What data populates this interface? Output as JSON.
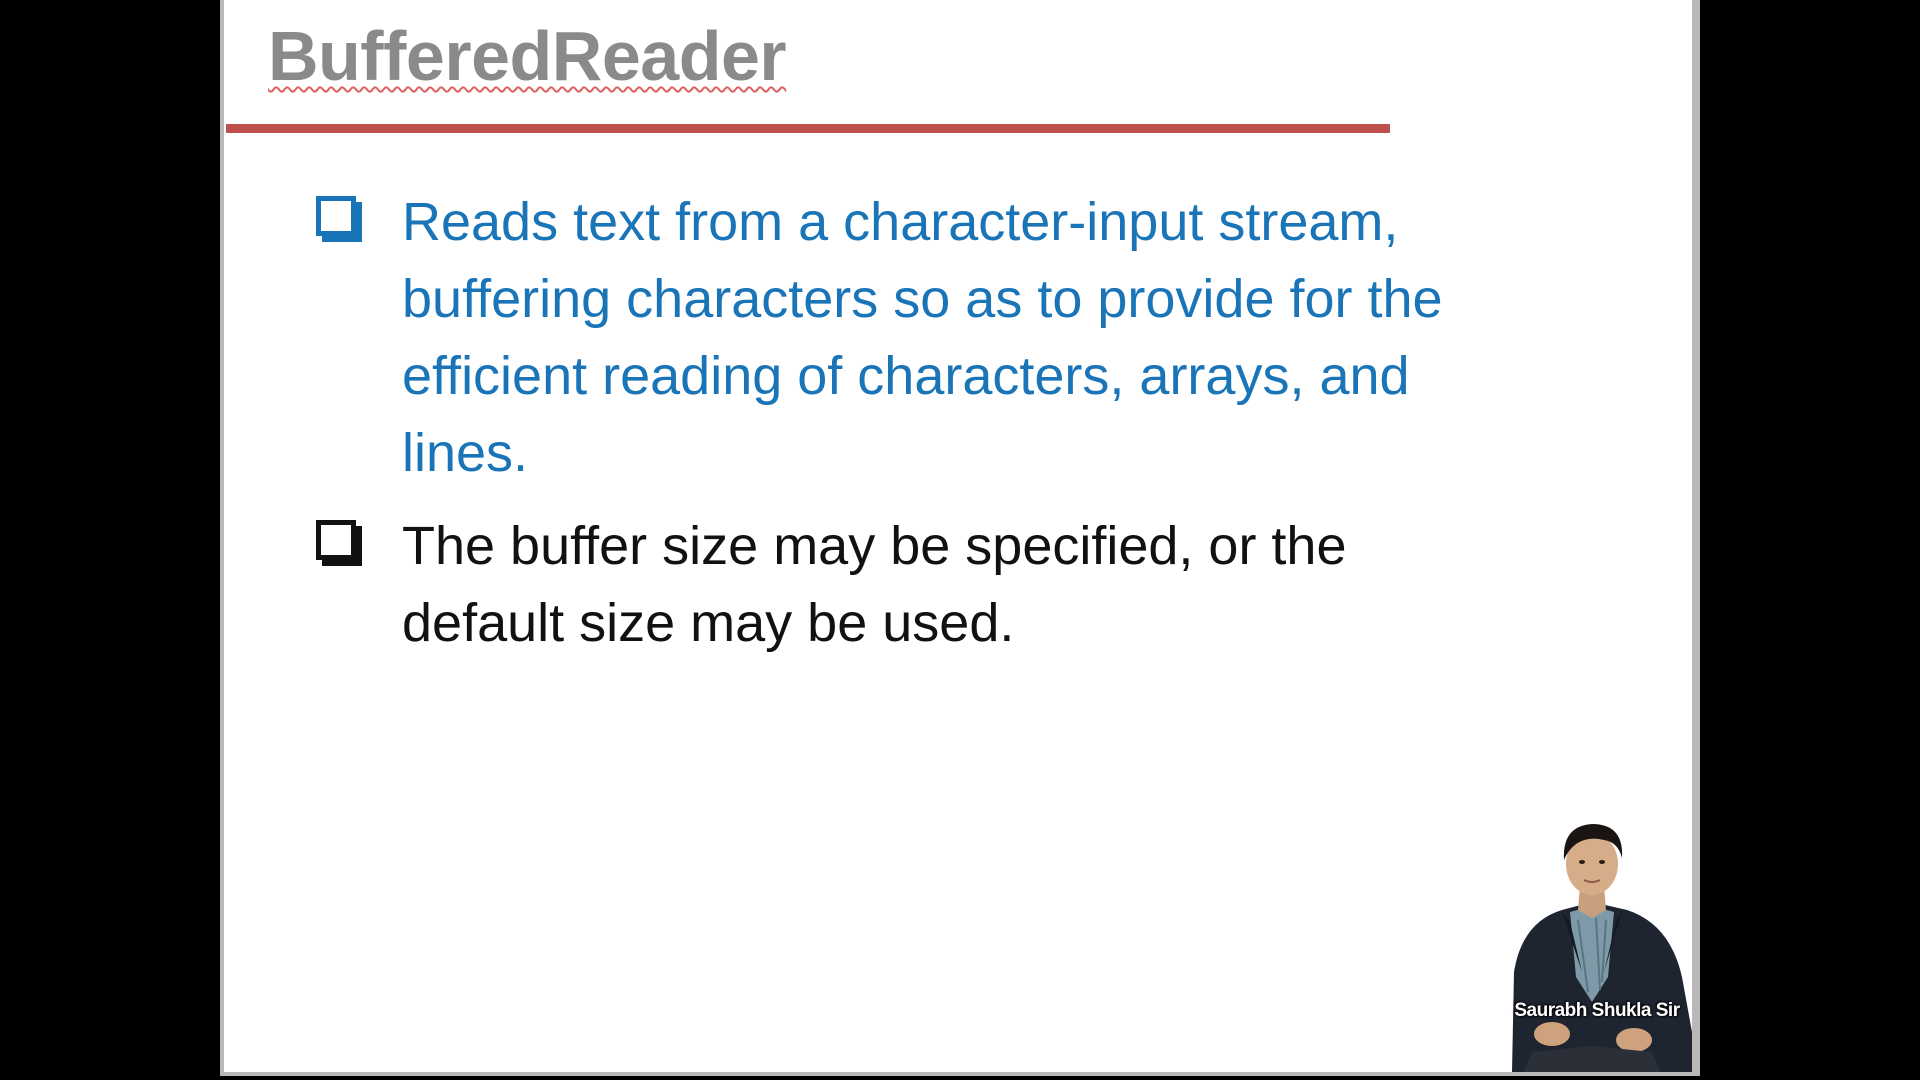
{
  "slide": {
    "title": "BufferedReader",
    "bullets": [
      {
        "lines": [
          "Reads text from a character-input stream,",
          "buffering characters so as to provide for the",
          "efficient reading of characters, arrays, and",
          "lines."
        ]
      },
      {
        "lines": [
          "The buffer size may be specified, or the",
          "default size may be used."
        ]
      }
    ],
    "presenter_name": "Saurabh Shukla Sir"
  },
  "colors": {
    "title": "#8a8a8a",
    "title_rule": "#c0504d",
    "bullet_1": "#1a74b8",
    "bullet_2": "#111111",
    "background_outer": "#000000",
    "slide_background": "#ffffff"
  },
  "icons": [
    "checkbox-bullet-icon",
    "presenter-photo"
  ]
}
